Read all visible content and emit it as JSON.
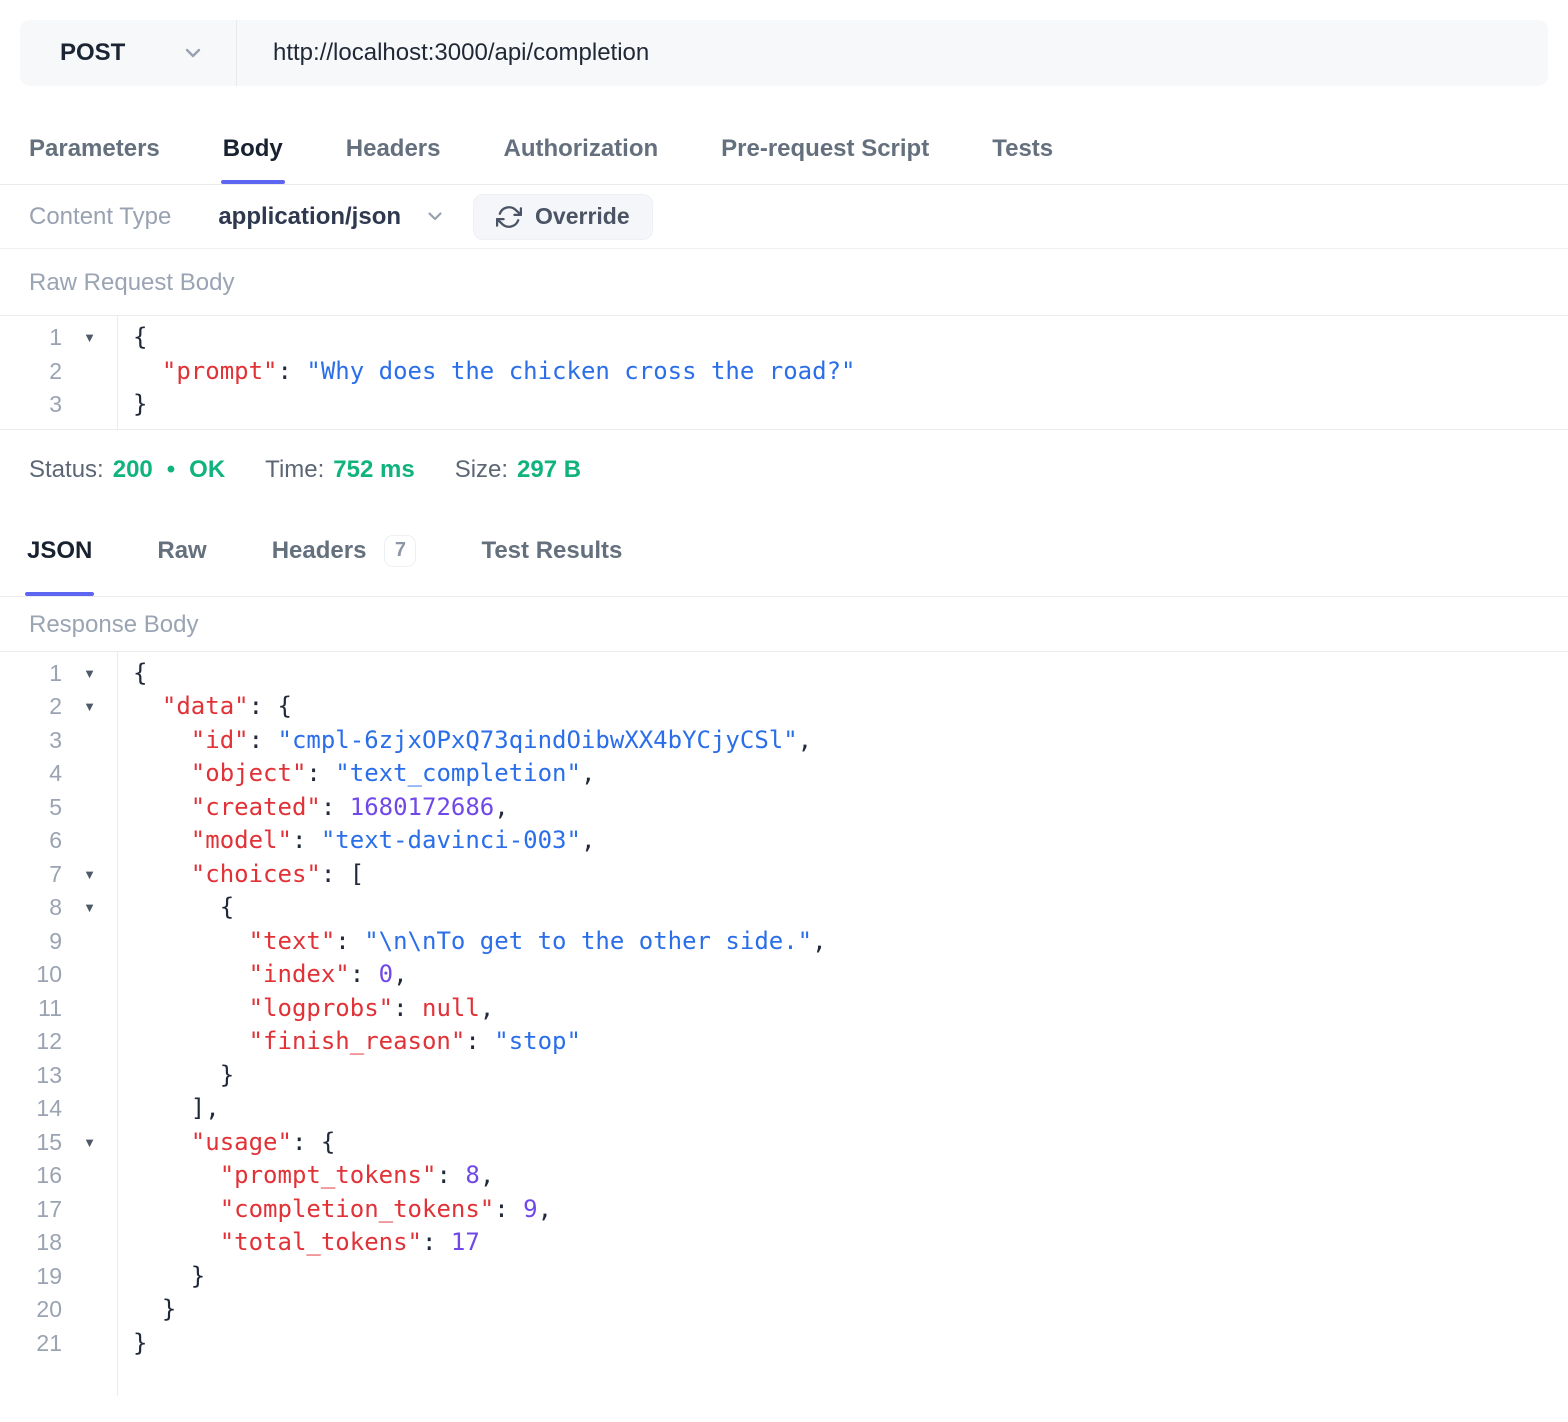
{
  "topbar": {
    "method": "POST",
    "url": "http://localhost:3000/api/completion"
  },
  "request_tabs": {
    "active": "Body",
    "items": [
      {
        "label": "Parameters"
      },
      {
        "label": "Body"
      },
      {
        "label": "Headers"
      },
      {
        "label": "Authorization"
      },
      {
        "label": "Pre-request Script"
      },
      {
        "label": "Tests"
      }
    ]
  },
  "content_type": {
    "label": "Content Type",
    "value": "application/json",
    "override_label": "Override"
  },
  "request_section": {
    "title": "Raw Request Body"
  },
  "request_editor": {
    "lines": [
      {
        "no": "1",
        "fold": true,
        "tokens": [
          {
            "c": "pun",
            "t": "{"
          }
        ]
      },
      {
        "no": "2",
        "tokens": [
          {
            "c": "pun",
            "t": "  "
          },
          {
            "c": "key",
            "t": "\"prompt\""
          },
          {
            "c": "pun",
            "t": ": "
          },
          {
            "c": "str",
            "t": "\"Why does the chicken cross the road?\""
          }
        ]
      },
      {
        "no": "3",
        "tokens": [
          {
            "c": "pun",
            "t": "}"
          }
        ]
      }
    ]
  },
  "status_bar": {
    "status_label": "Status:",
    "status_code": "200",
    "status_dot": "•",
    "status_text": "OK",
    "time_label": "Time:",
    "time_value": "752 ms",
    "size_label": "Size:",
    "size_value": "297 B"
  },
  "response_tabs": {
    "active": "JSON",
    "json_label": "JSON",
    "raw_label": "Raw",
    "headers_label": "Headers",
    "headers_badge": "7",
    "test_results_label": "Test Results"
  },
  "response_section": {
    "title": "Response Body"
  },
  "response_editor": {
    "lines": [
      {
        "no": "1",
        "fold": true,
        "tokens": [
          {
            "c": "pun",
            "t": "{"
          }
        ]
      },
      {
        "no": "2",
        "fold": true,
        "tokens": [
          {
            "c": "pun",
            "t": "  "
          },
          {
            "c": "key",
            "t": "\"data\""
          },
          {
            "c": "pun",
            "t": ": {"
          }
        ]
      },
      {
        "no": "3",
        "tokens": [
          {
            "c": "pun",
            "t": "    "
          },
          {
            "c": "key",
            "t": "\"id\""
          },
          {
            "c": "pun",
            "t": ": "
          },
          {
            "c": "str",
            "t": "\"cmpl-6zjxOPxQ73qindOibwXX4bYCjyCSl\""
          },
          {
            "c": "pun",
            "t": ","
          }
        ]
      },
      {
        "no": "4",
        "tokens": [
          {
            "c": "pun",
            "t": "    "
          },
          {
            "c": "key",
            "t": "\"object\""
          },
          {
            "c": "pun",
            "t": ": "
          },
          {
            "c": "str",
            "t": "\"text_completion\""
          },
          {
            "c": "pun",
            "t": ","
          }
        ]
      },
      {
        "no": "5",
        "tokens": [
          {
            "c": "pun",
            "t": "    "
          },
          {
            "c": "key",
            "t": "\"created\""
          },
          {
            "c": "pun",
            "t": ": "
          },
          {
            "c": "num",
            "t": "1680172686"
          },
          {
            "c": "pun",
            "t": ","
          }
        ]
      },
      {
        "no": "6",
        "tokens": [
          {
            "c": "pun",
            "t": "    "
          },
          {
            "c": "key",
            "t": "\"model\""
          },
          {
            "c": "pun",
            "t": ": "
          },
          {
            "c": "str",
            "t": "\"text-davinci-003\""
          },
          {
            "c": "pun",
            "t": ","
          }
        ]
      },
      {
        "no": "7",
        "fold": true,
        "tokens": [
          {
            "c": "pun",
            "t": "    "
          },
          {
            "c": "key",
            "t": "\"choices\""
          },
          {
            "c": "pun",
            "t": ": ["
          }
        ]
      },
      {
        "no": "8",
        "fold": true,
        "tokens": [
          {
            "c": "pun",
            "t": "      {"
          }
        ]
      },
      {
        "no": "9",
        "tokens": [
          {
            "c": "pun",
            "t": "        "
          },
          {
            "c": "key",
            "t": "\"text\""
          },
          {
            "c": "pun",
            "t": ": "
          },
          {
            "c": "str",
            "t": "\"\\n\\nTo get to the other side.\""
          },
          {
            "c": "pun",
            "t": ","
          }
        ]
      },
      {
        "no": "10",
        "tokens": [
          {
            "c": "pun",
            "t": "        "
          },
          {
            "c": "key",
            "t": "\"index\""
          },
          {
            "c": "pun",
            "t": ": "
          },
          {
            "c": "num",
            "t": "0"
          },
          {
            "c": "pun",
            "t": ","
          }
        ]
      },
      {
        "no": "11",
        "tokens": [
          {
            "c": "pun",
            "t": "        "
          },
          {
            "c": "key",
            "t": "\"logprobs\""
          },
          {
            "c": "pun",
            "t": ": "
          },
          {
            "c": "nul",
            "t": "null"
          },
          {
            "c": "pun",
            "t": ","
          }
        ]
      },
      {
        "no": "12",
        "tokens": [
          {
            "c": "pun",
            "t": "        "
          },
          {
            "c": "key",
            "t": "\"finish_reason\""
          },
          {
            "c": "pun",
            "t": ": "
          },
          {
            "c": "str",
            "t": "\"stop\""
          }
        ]
      },
      {
        "no": "13",
        "tokens": [
          {
            "c": "pun",
            "t": "      }"
          }
        ]
      },
      {
        "no": "14",
        "tokens": [
          {
            "c": "pun",
            "t": "    ],"
          }
        ]
      },
      {
        "no": "15",
        "fold": true,
        "tokens": [
          {
            "c": "pun",
            "t": "    "
          },
          {
            "c": "key",
            "t": "\"usage\""
          },
          {
            "c": "pun",
            "t": ": {"
          }
        ]
      },
      {
        "no": "16",
        "tokens": [
          {
            "c": "pun",
            "t": "      "
          },
          {
            "c": "key",
            "t": "\"prompt_tokens\""
          },
          {
            "c": "pun",
            "t": ": "
          },
          {
            "c": "num",
            "t": "8"
          },
          {
            "c": "pun",
            "t": ","
          }
        ]
      },
      {
        "no": "17",
        "tokens": [
          {
            "c": "pun",
            "t": "      "
          },
          {
            "c": "key",
            "t": "\"completion_tokens\""
          },
          {
            "c": "pun",
            "t": ": "
          },
          {
            "c": "num",
            "t": "9"
          },
          {
            "c": "pun",
            "t": ","
          }
        ]
      },
      {
        "no": "18",
        "tokens": [
          {
            "c": "pun",
            "t": "      "
          },
          {
            "c": "key",
            "t": "\"total_tokens\""
          },
          {
            "c": "pun",
            "t": ": "
          },
          {
            "c": "num",
            "t": "17"
          }
        ]
      },
      {
        "no": "19",
        "tokens": [
          {
            "c": "pun",
            "t": "    }"
          }
        ]
      },
      {
        "no": "20",
        "tokens": [
          {
            "c": "pun",
            "t": "  }"
          }
        ]
      },
      {
        "no": "21",
        "tokens": [
          {
            "c": "pun",
            "t": "}"
          }
        ]
      }
    ]
  },
  "icons": {
    "method_chevron": "chevron-down-icon",
    "content_type_chevron": "chevron-down-icon",
    "override_icon": "refresh-icon",
    "fold_icon": "fold-triangle-icon"
  },
  "colors": {
    "accent_purple": "#5e66f1",
    "success_green": "#10b37e",
    "json_key_red": "#e03237",
    "json_string_blue": "#2a6ee9",
    "json_number_purple": "#7048e8",
    "panel_gray": "#f7f8fa"
  }
}
